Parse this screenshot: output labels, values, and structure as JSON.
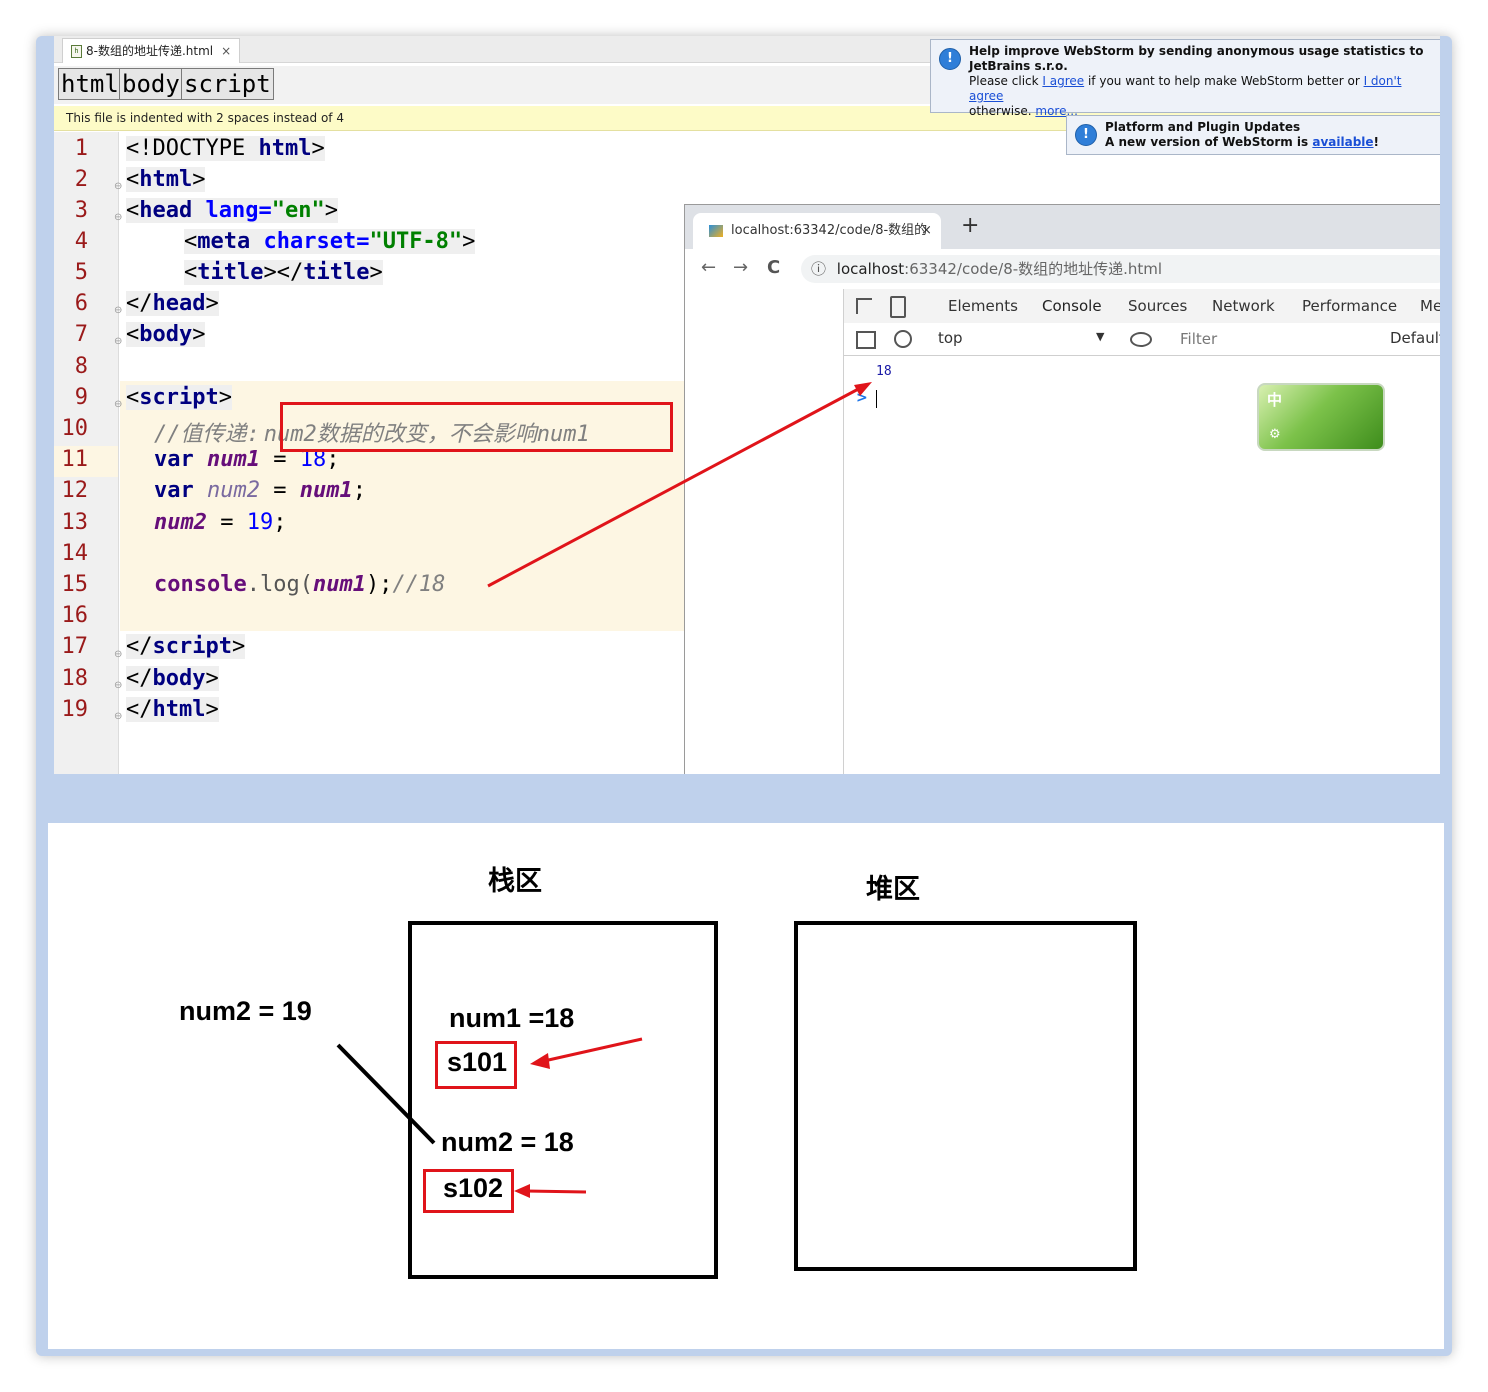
{
  "editor": {
    "file_tab": "8-数组的地址传递.html",
    "file_tab_close": "×",
    "file_icon_glyph": "h",
    "breadcrumbs": [
      "html",
      "body",
      "script"
    ],
    "indent_notice": "This file is indented with 2 spaces instead of 4",
    "line_numbers": [
      "1",
      "2",
      "3",
      "4",
      "5",
      "6",
      "7",
      "8",
      "9",
      "10",
      "11",
      "12",
      "13",
      "14",
      "15",
      "16",
      "17",
      "18",
      "19"
    ],
    "code": {
      "l1_a": "<!DOCTYPE ",
      "l1_b": "html",
      "l1_c": ">",
      "l2_a": "<",
      "l2_b": "html",
      "l2_c": ">",
      "l3_a": "<",
      "l3_b": "head",
      "l3_c": " lang=",
      "l3_d": "\"en\"",
      "l3_e": ">",
      "l4_a": "<",
      "l4_b": "meta",
      "l4_c": " charset=",
      "l4_d": "\"UTF-8\"",
      "l4_e": ">",
      "l5_a": "<",
      "l5_b": "title",
      "l5_c": "></",
      "l5_d": "title",
      "l5_e": ">",
      "l6_a": "</",
      "l6_b": "head",
      "l6_c": ">",
      "l7_a": "<",
      "l7_b": "body",
      "l7_c": ">",
      "l9_a": "<",
      "l9_b": "script",
      "l9_c": ">",
      "l10_a": "//值传递:",
      "l10_b": "num2数据的改变，不会影响num1",
      "l11_a": "var ",
      "l11_b": "num1",
      "l11_c": " = ",
      "l11_d": "18",
      "l11_e": ";",
      "l12_a": "var ",
      "l12_b": "num2",
      "l12_c": " = ",
      "l12_d": "num1",
      "l12_e": ";",
      "l13_a": "num2",
      "l13_b": " = ",
      "l13_c": "19",
      "l13_d": ";",
      "l15_a": "console",
      "l15_b": ".log(",
      "l15_c": "num1",
      "l15_d": ");",
      "l15_e": "//18",
      "l17_a": "</",
      "l17_b": "script",
      "l17_c": ">",
      "l18_a": "</",
      "l18_b": "body",
      "l18_c": ">",
      "l19_a": "</",
      "l19_b": "html",
      "l19_c": ">"
    }
  },
  "notifications": {
    "stats": {
      "title": "Help improve WebStorm by sending anonymous usage statistics to JetBrains s.r.o.",
      "body_a": "Please click ",
      "agree": "I agree",
      "body_b": " if you want to help make WebStorm better or ",
      "disagree": "I don't agree",
      "body_c": "otherwise. ",
      "more": "more..."
    },
    "updates": {
      "title": "Platform and Plugin Updates",
      "body_a": "A new version of WebStorm is ",
      "available": "available",
      "body_b": "!"
    },
    "icon_glyph": "!"
  },
  "browser": {
    "tab_title": "localhost:63342/code/8-数组的",
    "tab_close": "×",
    "new_tab": "+",
    "nav_back": "←",
    "nav_forward": "→",
    "nav_reload": "C",
    "info_glyph": "ⓘ",
    "url_host": "localhost",
    "url_rest": ":63342/code/8-数组的地址传递.html",
    "devtools_tabs": [
      "Elements",
      "Console",
      "Sources",
      "Network",
      "Performance",
      "Me"
    ],
    "active_tab": "Console",
    "context": "top",
    "context_arrow": "▼",
    "filter_placeholder": "Filter",
    "levels": "Default",
    "console_output": "18",
    "prompt": ">",
    "ime_char": "中"
  },
  "diagram": {
    "stack_title": "栈区",
    "heap_title": "堆区",
    "outside_label": "num2 = 19",
    "num1_label": "num1 =18",
    "num1_addr": "s101",
    "num2_label": "num2 = 18",
    "num2_addr": "s102"
  },
  "colors": {
    "frame": "#bfd1ec",
    "annotation_red": "#e0141a",
    "notice_yellow": "#fdfbc7",
    "code_bg": "#fdf6e3"
  }
}
